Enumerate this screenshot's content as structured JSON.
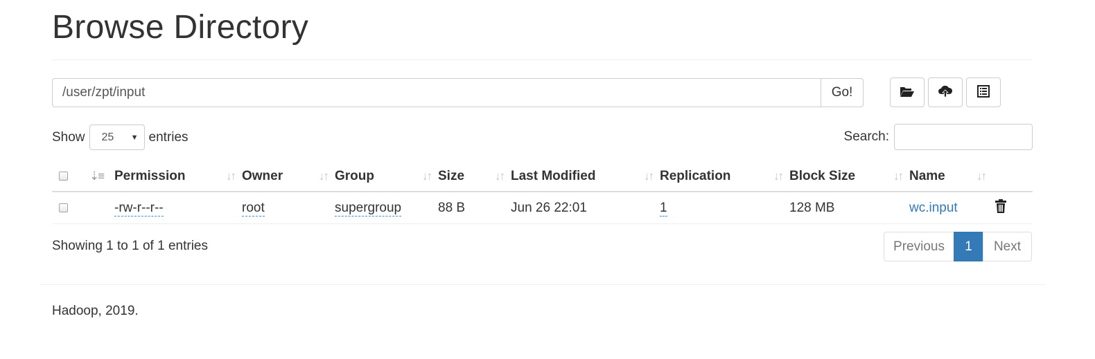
{
  "page": {
    "title": "Browse Directory"
  },
  "path": {
    "value": "/user/zpt/input",
    "go_label": "Go!"
  },
  "toolbar": {
    "icons": [
      "folder-open-icon",
      "cloud-upload-icon",
      "list-alt-icon"
    ]
  },
  "length": {
    "show_label": "Show",
    "value": "25",
    "entries_label": "entries"
  },
  "search": {
    "label": "Search:",
    "value": ""
  },
  "table": {
    "columns": [
      "Permission",
      "Owner",
      "Group",
      "Size",
      "Last Modified",
      "Replication",
      "Block Size",
      "Name"
    ],
    "rows": [
      {
        "permission": "-rw-r--r--",
        "owner": "root",
        "group": "supergroup",
        "size": "88 B",
        "last_modified": "Jun 26 22:01",
        "replication": "1",
        "block_size": "128 MB",
        "name": "wc.input"
      }
    ]
  },
  "info": {
    "text": "Showing 1 to 1 of 1 entries"
  },
  "pagination": {
    "previous": "Previous",
    "current": "1",
    "next": "Next"
  },
  "footer": {
    "text": "Hadoop, 2019."
  },
  "colors": {
    "link": "#337ab7",
    "active_page": "#337ab7"
  }
}
